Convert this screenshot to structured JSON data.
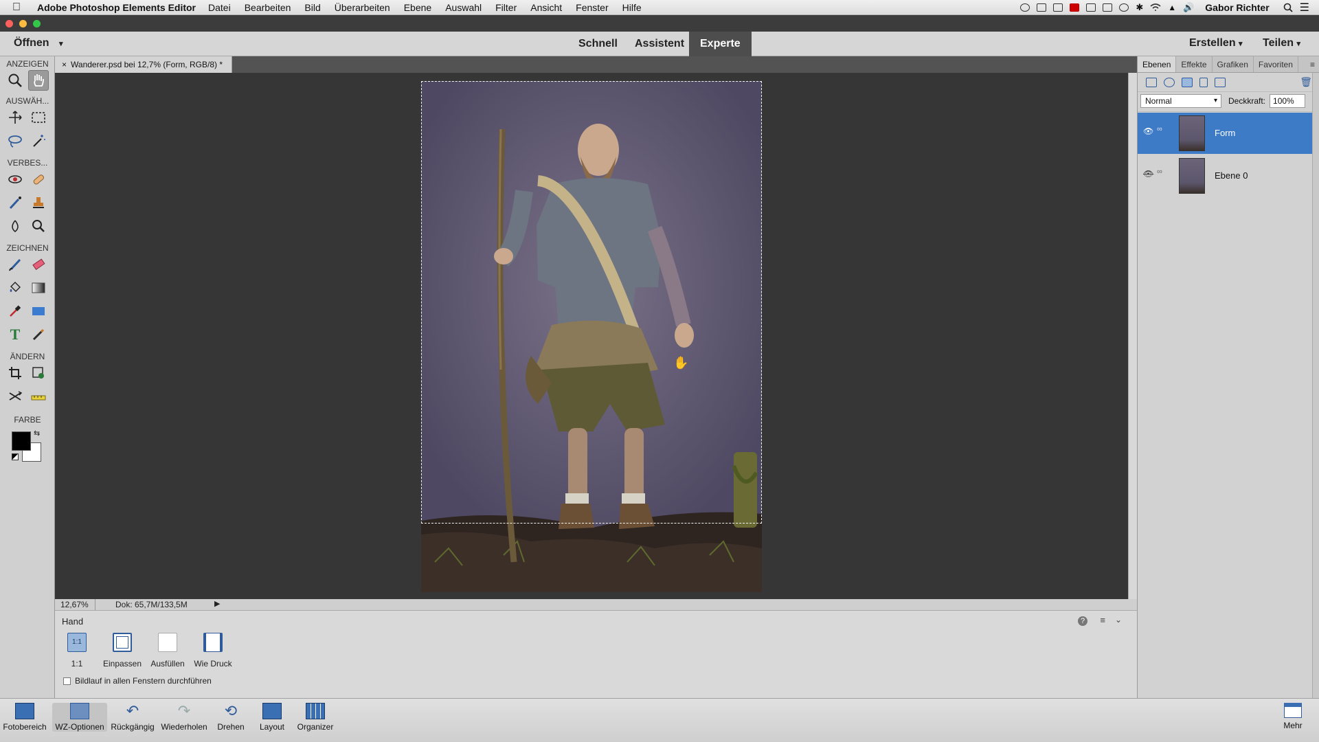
{
  "menubar": {
    "app_name": "Adobe Photoshop Elements Editor",
    "items": [
      "Datei",
      "Bearbeiten",
      "Bild",
      "Überarbeiten",
      "Ebene",
      "Auswahl",
      "Filter",
      "Ansicht",
      "Fenster",
      "Hilfe"
    ],
    "user": "Gabor Richter"
  },
  "modebar": {
    "open_label": "Öffnen",
    "modes": [
      "Schnell",
      "Assistent",
      "Experte"
    ],
    "active_mode": "Experte",
    "create_label": "Erstellen",
    "share_label": "Teilen"
  },
  "toolbox": {
    "sections": {
      "view": "ANZEIGEN",
      "select": "AUSWÄH...",
      "enhance": "VERBES...",
      "draw": "ZEICHNEN",
      "modify": "ÄNDERN",
      "color": "FARBE"
    },
    "foreground_color": "#000000",
    "background_color": "#ffffff"
  },
  "document": {
    "tab_title": "Wanderer.psd bei 12,7% (Form, RGB/8) *",
    "zoom": "12,67%",
    "doc_size": "Dok: 65,7M/133,5M"
  },
  "options": {
    "tool_name": "Hand",
    "buttons": [
      "1:1",
      "Einpassen",
      "Ausfüllen",
      "Wie Druck"
    ],
    "button_1_icon_text": "1:1",
    "scroll_all_label": "Bildlauf in allen Fenstern durchführen",
    "help_icon": "?"
  },
  "layers_panel": {
    "tabs": [
      "Ebenen",
      "Effekte",
      "Grafiken",
      "Favoriten"
    ],
    "blend_mode": "Normal",
    "opacity_label": "Deckkraft:",
    "opacity_value": "100%",
    "layers": [
      {
        "name": "Form",
        "visible": true,
        "selected": true
      },
      {
        "name": "Ebene 0",
        "visible": false,
        "selected": false
      }
    ],
    "selected_color": "#3e7bc7"
  },
  "bottombar": {
    "buttons": [
      "Fotobereich",
      "WZ-Optionen",
      "Rückgängig",
      "Wiederholen",
      "Drehen",
      "Layout",
      "Organizer"
    ],
    "more_label": "Mehr"
  }
}
